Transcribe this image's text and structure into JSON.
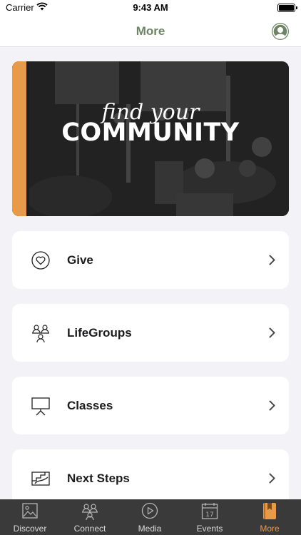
{
  "status_bar": {
    "carrier": "Carrier",
    "time": "9:43 AM"
  },
  "nav": {
    "title": "More"
  },
  "banner": {
    "script_text": "find your",
    "heading": "COMMUNITY",
    "accent_color": "#e79a4a"
  },
  "menu": [
    {
      "label": "Give",
      "icon": "heart-icon"
    },
    {
      "label": "LifeGroups",
      "icon": "people-group-icon"
    },
    {
      "label": "Classes",
      "icon": "presentation-board-icon"
    },
    {
      "label": "Next Steps",
      "icon": "steps-icon"
    }
  ],
  "tabs": [
    {
      "label": "Discover",
      "icon": "photo-icon",
      "active": false
    },
    {
      "label": "Connect",
      "icon": "people-icon",
      "active": false
    },
    {
      "label": "Media",
      "icon": "play-icon",
      "active": false
    },
    {
      "label": "Events",
      "icon": "calendar-icon",
      "active": false
    },
    {
      "label": "More",
      "icon": "bookmark-icon",
      "active": true
    }
  ],
  "calendar_icon_day": "17"
}
